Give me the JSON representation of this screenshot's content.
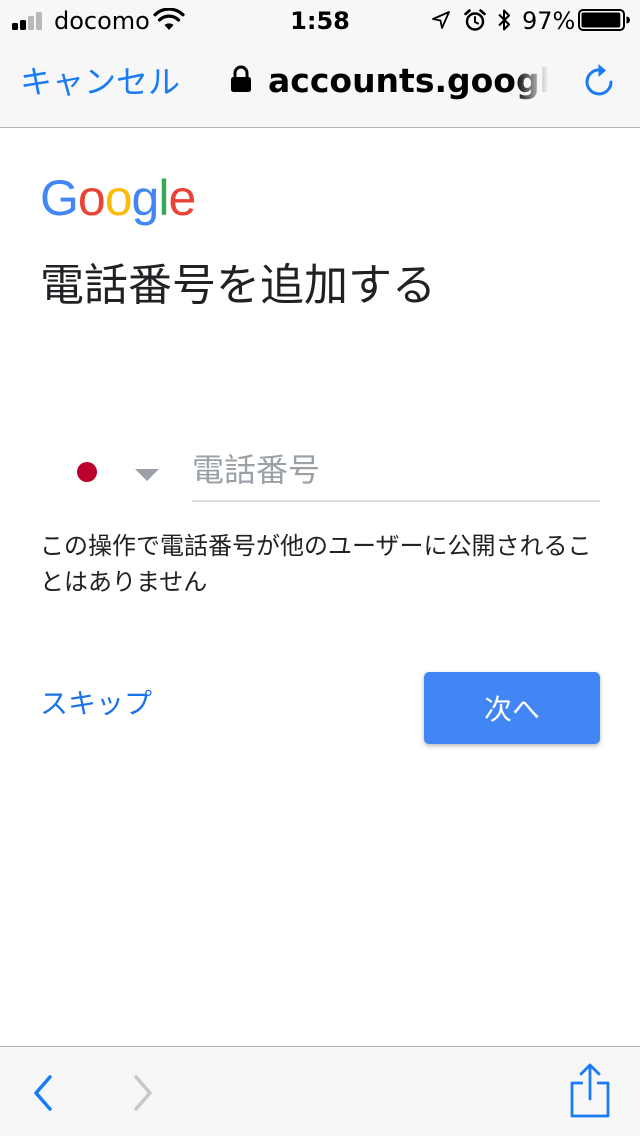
{
  "status_bar": {
    "carrier": "docomo",
    "time": "1:58",
    "battery_percent": "97%",
    "battery_level": 0.97,
    "signal_bars_filled": 2,
    "signal_bars_total": 4,
    "icons": [
      "signal-icon",
      "wifi-icon",
      "location-icon",
      "alarm-icon",
      "bluetooth-icon",
      "battery-icon"
    ]
  },
  "browser": {
    "cancel_label": "キャンセル",
    "url": "accounts.google.com",
    "icons": [
      "lock-icon",
      "reload-icon",
      "back-icon",
      "forward-icon",
      "share-icon"
    ],
    "forward_enabled": false
  },
  "page": {
    "logo_letters": [
      "G",
      "o",
      "o",
      "g",
      "l",
      "e"
    ],
    "logo_colors": [
      "#4285F4",
      "#EA4335",
      "#FBBC05",
      "#4285F4",
      "#34A853",
      "#EA4335"
    ],
    "title": "電話番号を追加する",
    "country_flag_color": "#BC002D",
    "phone_placeholder": "電話番号",
    "phone_value": "",
    "privacy_note": "この操作で電話番号が他のユーザーに公開されることはありません",
    "skip_label": "スキップ",
    "next_label": "次へ"
  },
  "colors": {
    "ios_blue": "#1A7CF5",
    "link_blue": "#1A73E8",
    "primary_button": "#4285F4",
    "chrome_background": "#F7F7F7",
    "disabled_gray": "#C7C7CC"
  }
}
